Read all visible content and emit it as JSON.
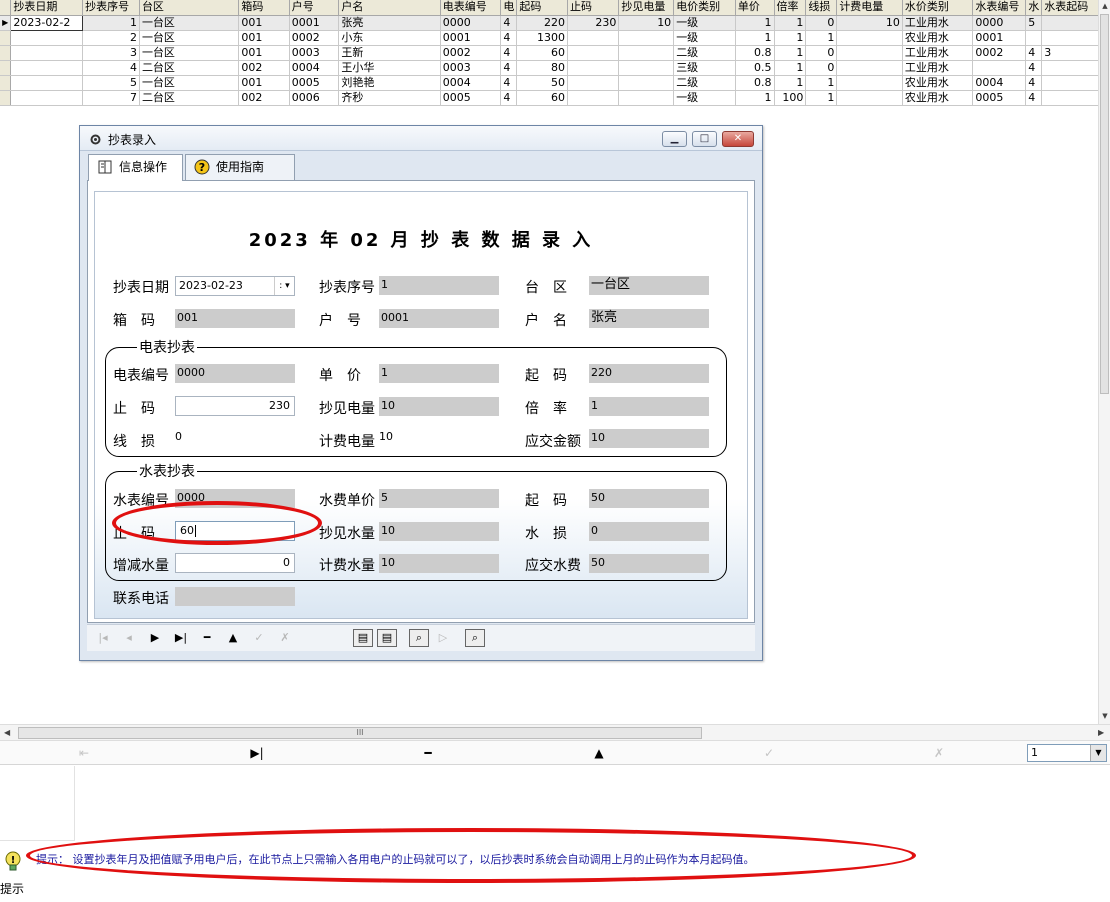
{
  "grid": {
    "columns": [
      "抄表日期",
      "抄表序号",
      "台区",
      "箱码",
      "户号",
      "户名",
      "电表编号",
      "电",
      "起码",
      "止码",
      "抄见电量",
      "电价类别",
      "单价",
      "倍率",
      "线损",
      "计费电量",
      "水价类别",
      "水表编号",
      "水",
      "水表起码"
    ],
    "rows": [
      [
        "2023-02-2",
        "1",
        "一台区",
        "001",
        "0001",
        "张亮",
        "0000",
        "4",
        "220",
        "230",
        "10",
        "一级",
        "1",
        "1",
        "0",
        "10",
        "工业用水",
        "0000",
        "5",
        ""
      ],
      [
        "",
        "2",
        "一台区",
        "001",
        "0002",
        "小东",
        "0001",
        "4",
        "1300",
        "",
        "",
        "一级",
        "1",
        "1",
        "1",
        "",
        "农业用水",
        "0001",
        "",
        ""
      ],
      [
        "",
        "3",
        "一台区",
        "001",
        "0003",
        "王新",
        "0002",
        "4",
        "60",
        "",
        "",
        "二级",
        "0.8",
        "1",
        "0",
        "",
        "工业用水",
        "0002",
        "4",
        "3"
      ],
      [
        "",
        "4",
        "二台区",
        "002",
        "0004",
        "王小华",
        "0003",
        "4",
        "80",
        "",
        "",
        "三级",
        "0.5",
        "1",
        "0",
        "",
        "工业用水",
        "",
        "4",
        ""
      ],
      [
        "",
        "5",
        "一台区",
        "001",
        "0005",
        "刘艳艳",
        "0004",
        "4",
        "50",
        "",
        "",
        "二级",
        "0.8",
        "1",
        "1",
        "",
        "农业用水",
        "0004",
        "4",
        ""
      ],
      [
        "",
        "7",
        "二台区",
        "002",
        "0006",
        "齐秒",
        "0005",
        "4",
        "60",
        "",
        "",
        "一级",
        "1",
        "100",
        "1",
        "",
        "农业用水",
        "0005",
        "4",
        ""
      ]
    ]
  },
  "hscroll_thumb": "III",
  "nav_select_value": "1",
  "dialog": {
    "title": "抄表录入",
    "tabs": [
      "信息操作",
      "使用指南"
    ],
    "heading": "2023 年 02 月 抄 表 数 据 录 入",
    "labels": {
      "date": "抄表日期",
      "seq": "抄表序号",
      "area": "台　区",
      "box": "箱　码",
      "household": "户　号",
      "name": "户　名",
      "elec_group": "电表抄表",
      "meter_no": "电表编号",
      "price": "单　价",
      "start": "起　码",
      "end": "止　码",
      "read_usage": "抄见电量",
      "ratio": "倍　率",
      "loss": "线　损",
      "bill_usage": "计费电量",
      "amount_due": "应交金额",
      "water_group": "水表抄表",
      "water_meter_no": "水表编号",
      "water_price": "水费单价",
      "water_start": "起　码",
      "water_end": "止　码",
      "water_read": "抄见水量",
      "water_loss": "水　损",
      "water_adj": "增减水量",
      "water_bill": "计费水量",
      "water_fee": "应交水费",
      "phone": "联系电话"
    },
    "values": {
      "date": "2023-02-23",
      "seq": "1",
      "area": "一台区",
      "box": "001",
      "household": "0001",
      "name": "张亮",
      "meter_no": "0000",
      "price": "1",
      "start": "220",
      "end": "230",
      "read_usage": "10",
      "ratio": "1",
      "loss": "0",
      "bill_usage": "10",
      "amount_due": "10",
      "water_meter_no": "0000",
      "water_price": "5",
      "water_start": "50",
      "water_end": "60",
      "water_read": "10",
      "water_loss": "0",
      "water_adj": "0",
      "water_bill": "10",
      "water_fee": "50",
      "phone": ""
    }
  },
  "hint": {
    "label": "提示",
    "text": "提示： 设置抄表年月及把值赋予用电户后，在此节点上只需输入各用电户的止码就可以了，以后抄表时系统会自动调用上月的止码作为本月起码值。"
  }
}
